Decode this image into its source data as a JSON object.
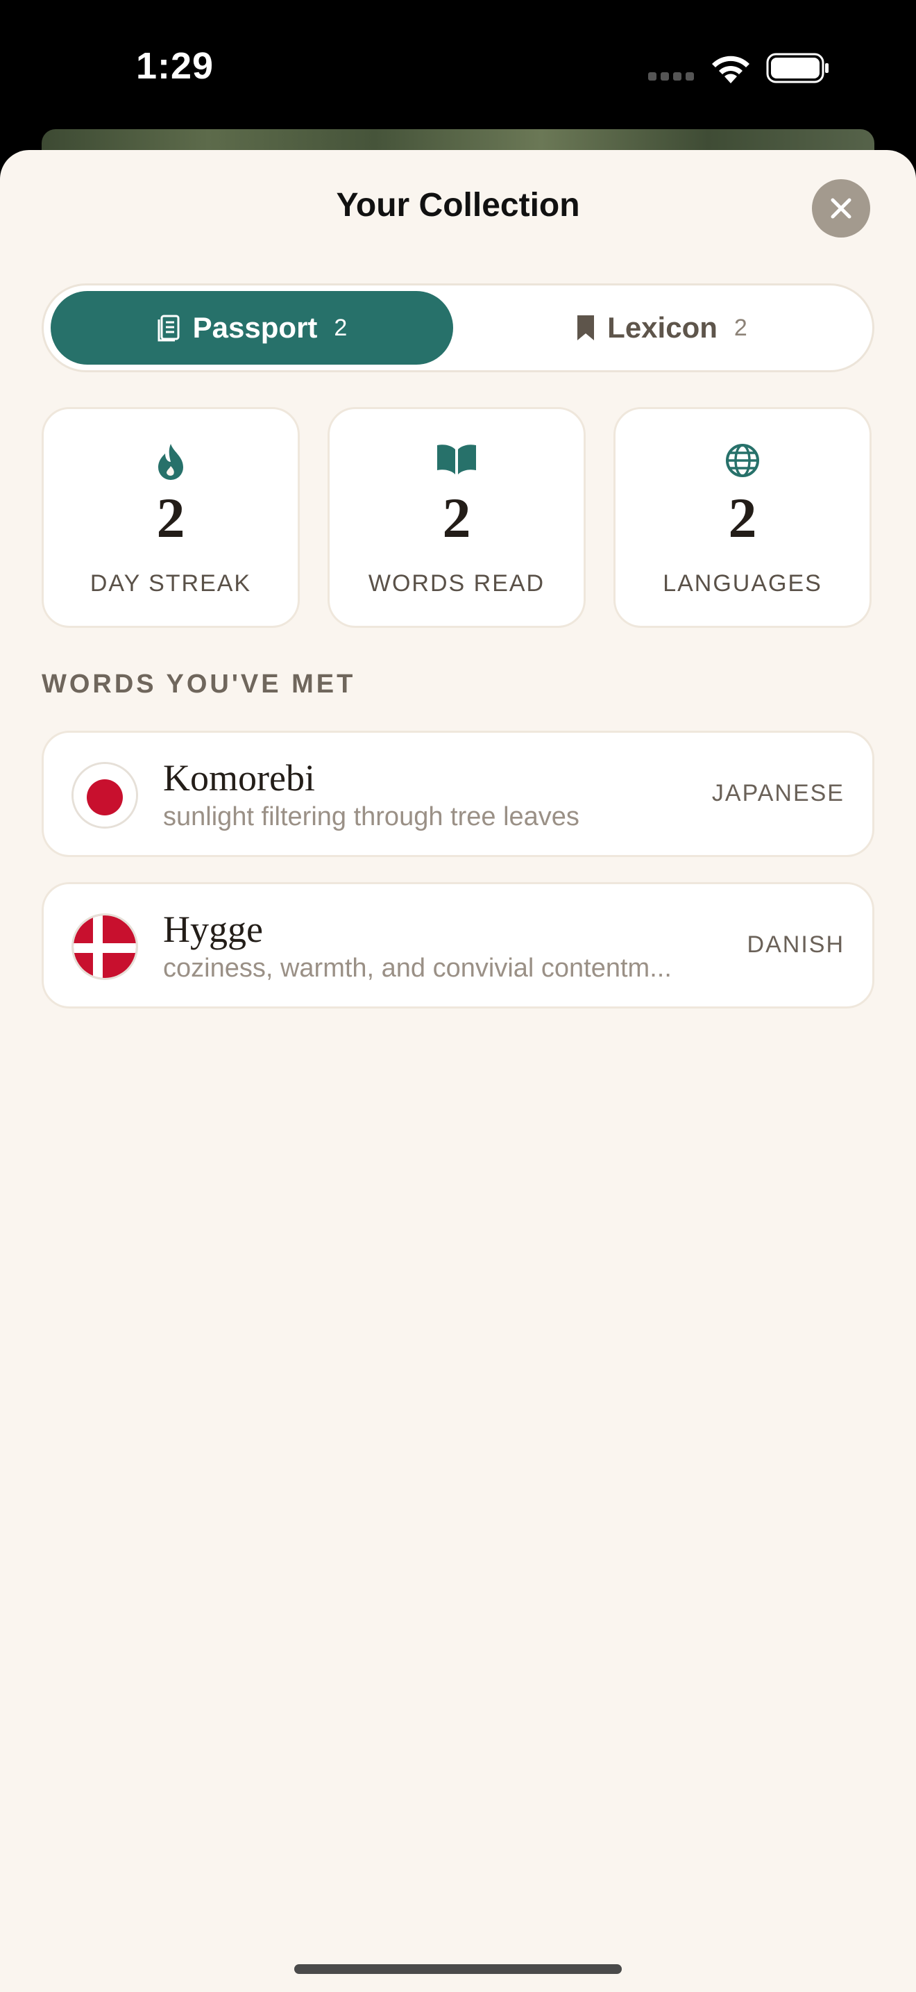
{
  "status_bar": {
    "time": "1:29"
  },
  "sheet": {
    "title": "Your Collection",
    "close_icon": "close-icon"
  },
  "tabs": [
    {
      "label": "Passport",
      "count": "2",
      "icon": "passport-icon",
      "selected": true
    },
    {
      "label": "Lexicon",
      "count": "2",
      "icon": "bookmark-icon",
      "selected": false
    }
  ],
  "stats": [
    {
      "value": "2",
      "label": "DAY STREAK",
      "icon": "flame-icon"
    },
    {
      "value": "2",
      "label": "WORDS READ",
      "icon": "open-book-icon"
    },
    {
      "value": "2",
      "label": "LANGUAGES",
      "icon": "globe-icon"
    }
  ],
  "section_header": "WORDS YOU'VE MET",
  "words": [
    {
      "word": "Komorebi",
      "definition": "sunlight filtering through tree leaves",
      "language": "JAPANESE",
      "flag": "japan-flag-icon"
    },
    {
      "word": "Hygge",
      "definition": "coziness, warmth, and convivial contentm...",
      "language": "DANISH",
      "flag": "denmark-flag-icon"
    }
  ],
  "colors": {
    "accent": "#27716a",
    "sheet_background": "#faf5ef",
    "card_border": "#efe7dc",
    "close_button": "#a39a8e"
  }
}
